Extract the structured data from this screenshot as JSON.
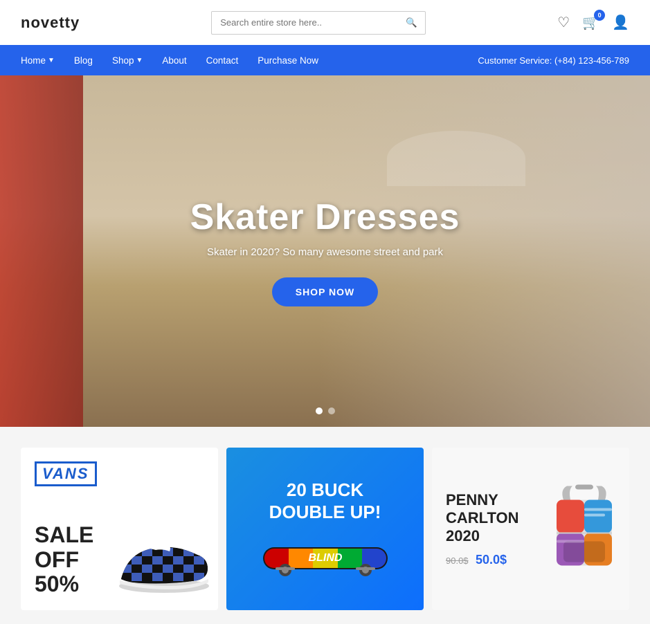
{
  "header": {
    "logo": "novetty",
    "search_placeholder": "Search entire store here..",
    "cart_count": "0",
    "icons": {
      "wishlist": "♡",
      "cart": "🛒",
      "account": "👤"
    }
  },
  "nav": {
    "items": [
      {
        "label": "Home",
        "has_dropdown": true
      },
      {
        "label": "Blog",
        "has_dropdown": false
      },
      {
        "label": "Shop",
        "has_dropdown": true
      },
      {
        "label": "About",
        "has_dropdown": false
      },
      {
        "label": "Contact",
        "has_dropdown": false
      },
      {
        "label": "Purchase Now",
        "has_dropdown": false
      }
    ],
    "customer_service_label": "Customer Service:",
    "customer_service_phone": "(+84) 123-456-789"
  },
  "hero": {
    "title": "Skater Dresses",
    "subtitle": "Skater in 2020? So many awesome street and park",
    "cta_label": "SHOP NOW",
    "dot1_active": true,
    "dot2_active": false
  },
  "cards": {
    "card1": {
      "brand": "VANS",
      "line1": "SALE",
      "line2": "OFF",
      "line3": "50%"
    },
    "card2": {
      "line1": "20 BUCK",
      "line2": "DOUBLE UP!"
    },
    "card3": {
      "title_line1": "PENNY",
      "title_line2": "CARLTON",
      "title_line3": "2020",
      "price_old": "90.0$",
      "price_new": "50.0$"
    }
  }
}
